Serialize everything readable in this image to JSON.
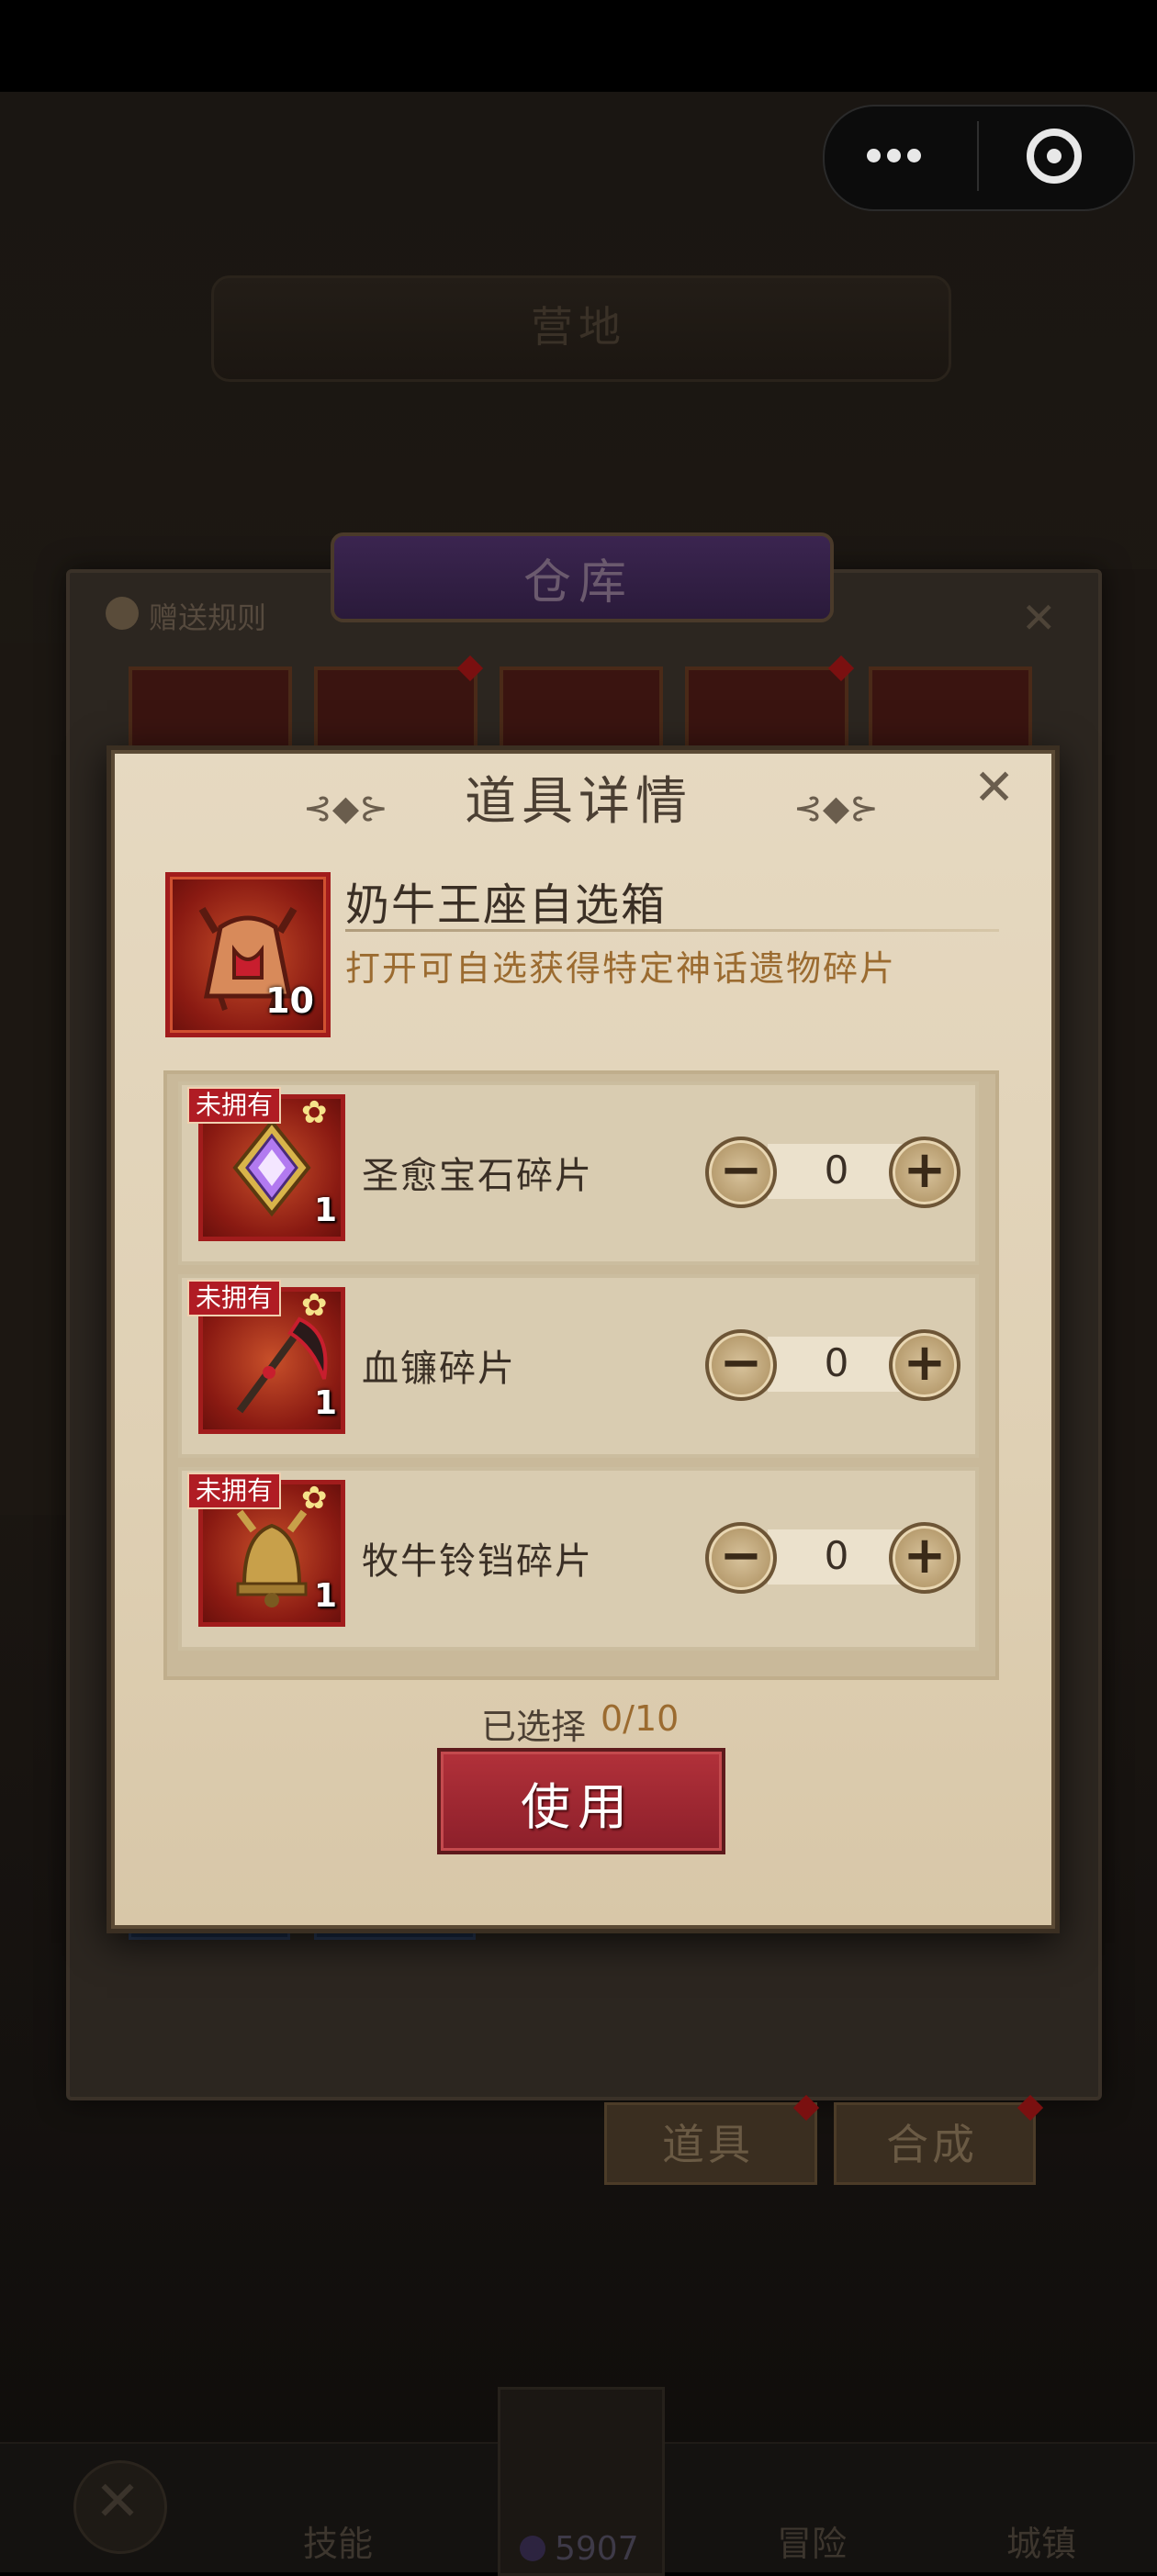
{
  "background": {
    "scene_title": "营地",
    "warehouse": {
      "title": "仓库",
      "gift_rule_label": "赠送规则",
      "close_glyph": "✕",
      "tabs": [
        {
          "label": "道具"
        },
        {
          "label": "合成"
        }
      ]
    },
    "bottom_nav": {
      "close_glyph": "✕",
      "items": [
        {
          "label": "技能"
        },
        {
          "label": "冒险"
        },
        {
          "label": "城镇"
        }
      ],
      "gem_count": "5907"
    }
  },
  "dialog": {
    "title": "道具详情",
    "close_glyph": "✕",
    "ornament": "⊰◆⊱",
    "item": {
      "name": "奶牛王座自选箱",
      "description": "打开可自选获得特定神话遗物碎片",
      "count": "10"
    },
    "options": [
      {
        "tag": "未拥有",
        "name": "圣愈宝石碎片",
        "count": "1",
        "quantity": "0",
        "icon": "holy-gem-icon"
      },
      {
        "tag": "未拥有",
        "name": "血镰碎片",
        "count": "1",
        "quantity": "0",
        "icon": "blood-scythe-icon"
      },
      {
        "tag": "未拥有",
        "name": "牧牛铃铛碎片",
        "count": "1",
        "quantity": "0",
        "icon": "cow-bell-icon"
      }
    ],
    "stepper": {
      "minus": "−",
      "plus": "+"
    },
    "selected": {
      "label": "已选择",
      "value": "0/10"
    },
    "use_button": "使用"
  },
  "status_capsule": {
    "more_icon": "more-dots-icon",
    "close_icon": "target-circle-icon"
  },
  "colors": {
    "dialog_bg": "#e2d5bb",
    "accent_gold": "#9b6b30",
    "use_button": "#a22a34",
    "tag_red": "#b01c24",
    "icon_frame": "#a11c1c"
  }
}
